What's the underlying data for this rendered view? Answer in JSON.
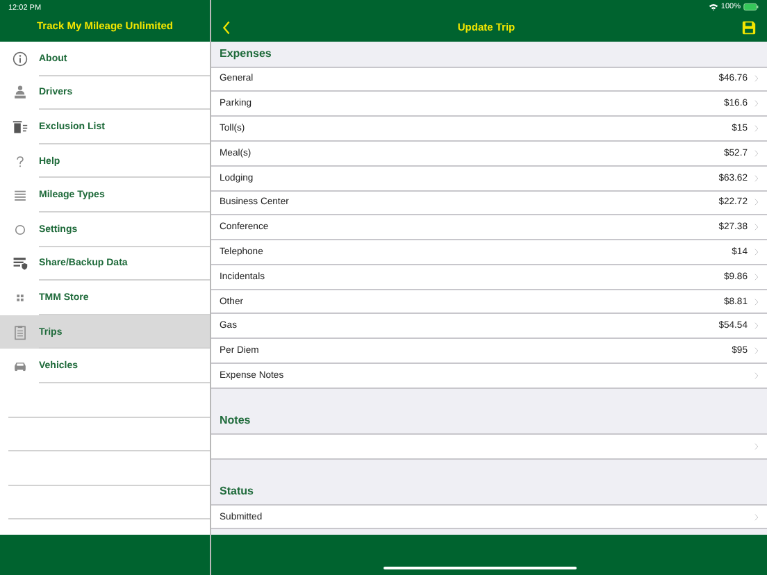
{
  "status_bar": {
    "time": "12:02 PM",
    "battery": "100%"
  },
  "sidebar": {
    "title": "Track My Mileage Unlimited",
    "items": [
      {
        "label": "About",
        "selected": false
      },
      {
        "label": "Drivers",
        "selected": false
      },
      {
        "label": "Exclusion List",
        "selected": false
      },
      {
        "label": "Help",
        "selected": false
      },
      {
        "label": "Mileage Types",
        "selected": false
      },
      {
        "label": "Settings",
        "selected": false
      },
      {
        "label": "Share/Backup Data",
        "selected": false
      },
      {
        "label": "TMM Store",
        "selected": false
      },
      {
        "label": "Trips",
        "selected": true
      },
      {
        "label": "Vehicles",
        "selected": false
      }
    ]
  },
  "detail": {
    "title": "Update Trip",
    "sections": [
      {
        "header": "Expenses",
        "rows": [
          {
            "label": "General",
            "value": "$46.76"
          },
          {
            "label": "Parking",
            "value": "$16.6"
          },
          {
            "label": "Toll(s)",
            "value": "$15"
          },
          {
            "label": "Meal(s)",
            "value": "$52.7"
          },
          {
            "label": "Lodging",
            "value": "$63.62"
          },
          {
            "label": "Business Center",
            "value": "$22.72"
          },
          {
            "label": "Conference",
            "value": "$27.38"
          },
          {
            "label": "Telephone",
            "value": "$14"
          },
          {
            "label": "Incidentals",
            "value": "$9.86"
          },
          {
            "label": "Other",
            "value": "$8.81"
          },
          {
            "label": "Gas",
            "value": "$54.54"
          },
          {
            "label": "Per Diem",
            "value": "$95"
          },
          {
            "label": "Expense Notes"
          }
        ]
      },
      {
        "header": "Notes",
        "rows": [
          {}
        ]
      },
      {
        "header": "Status",
        "rows": [
          {
            "label": "Submitted"
          }
        ]
      }
    ]
  }
}
